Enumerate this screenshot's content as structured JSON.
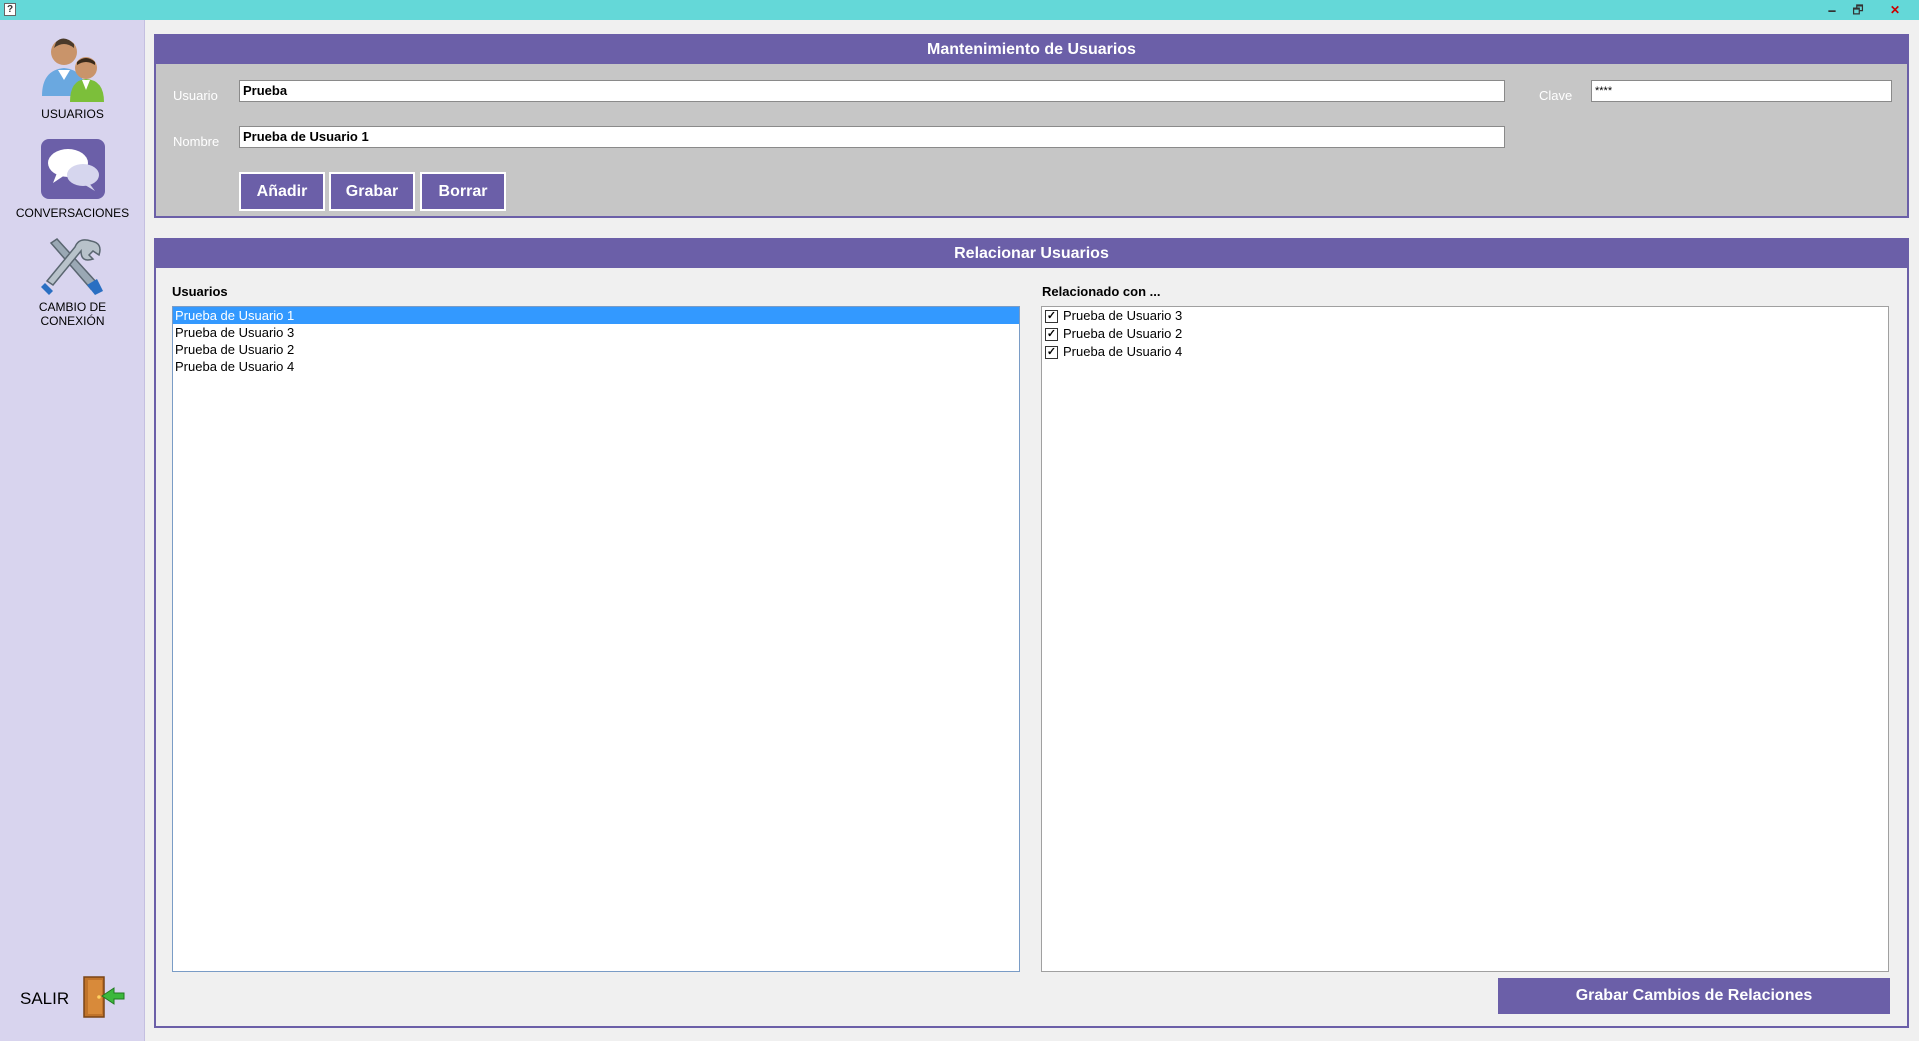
{
  "window": {
    "app_icon": "app-icon",
    "minimize_glyph": "🗕",
    "restore_glyph": "🗗",
    "close_glyph": "✕"
  },
  "sidebar": {
    "items": [
      {
        "label": "USUARIOS",
        "icon": "users-icon"
      },
      {
        "label": "CONVERSACIONES",
        "icon": "chat-bubbles-icon"
      },
      {
        "label_line1": "CAMBIO DE",
        "label_line2": "CONEXIÓN",
        "icon": "tools-icon"
      }
    ],
    "salir_label": "SALIR",
    "salir_icon": "exit-door-icon"
  },
  "mantenimiento": {
    "title": "Mantenimiento de Usuarios",
    "usuario_label": "Usuario",
    "usuario_value": "Prueba",
    "clave_label": "Clave",
    "clave_value": "****",
    "nombre_label": "Nombre",
    "nombre_value": "Prueba de Usuario 1",
    "buttons": {
      "anadir": "Añadir",
      "grabar": "Grabar",
      "borrar": "Borrar"
    }
  },
  "relacionar": {
    "title": "Relacionar Usuarios",
    "usuarios_title": "Usuarios",
    "usuarios": [
      {
        "label": "Prueba de Usuario 1",
        "selected": true
      },
      {
        "label": "Prueba de Usuario 3",
        "selected": false
      },
      {
        "label": "Prueba de Usuario 2",
        "selected": false
      },
      {
        "label": "Prueba de Usuario 4",
        "selected": false
      }
    ],
    "relacionado_title": "Relacionado con ...",
    "relacionados": [
      {
        "label": "Prueba de Usuario 3",
        "checked": true
      },
      {
        "label": "Prueba de Usuario 2",
        "checked": true
      },
      {
        "label": "Prueba de Usuario 4",
        "checked": true
      }
    ],
    "save_button": "Grabar Cambios de Relaciones"
  },
  "colors": {
    "titlebar": "#64d8d8",
    "accent": "#6b5fa8",
    "sidebar": "#d8d4ee",
    "selection": "#3399ff"
  }
}
